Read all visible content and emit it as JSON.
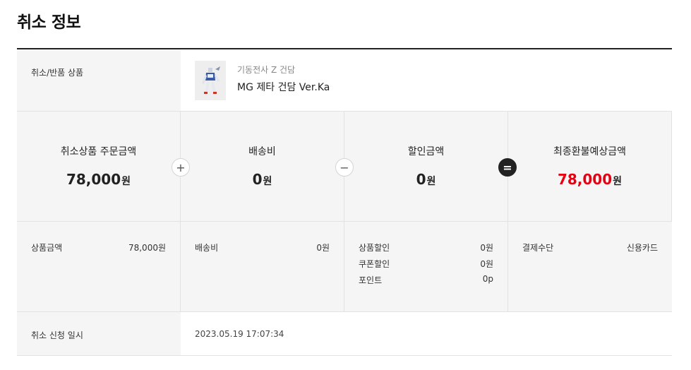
{
  "page_title": "취소 정보",
  "product": {
    "label": "취소/반품 상품",
    "category": "기동전사 Z 건담",
    "name": "MG 제타 건담 Ver.Ka"
  },
  "summary": [
    {
      "label": "취소상품 주문금액",
      "amount": "78,000",
      "unit": "원"
    },
    {
      "label": "배송비",
      "amount": "0",
      "unit": "원"
    },
    {
      "label": "할인금액",
      "amount": "0",
      "unit": "원"
    },
    {
      "label": "최종환불예상금액",
      "amount": "78,000",
      "unit": "원"
    }
  ],
  "operators": {
    "plus": "+",
    "minus": "−",
    "equals": "="
  },
  "details": {
    "product_amount": {
      "label": "상품금액",
      "value": "78,000원"
    },
    "shipping": {
      "label": "배송비",
      "value": "0원"
    },
    "discounts": [
      {
        "label": "상품할인",
        "value": "0원"
      },
      {
        "label": "쿠폰할인",
        "value": "0원"
      },
      {
        "label": "포인트",
        "value": "0p"
      }
    ],
    "payment": {
      "label": "결제수단",
      "value": "신용카드"
    }
  },
  "cancel_date": {
    "label": "취소 신청 일시",
    "value": "2023.05.19 17:07:34"
  },
  "colors": {
    "accent_red": "#e60013",
    "dark": "#222222",
    "panel": "#f5f5f5"
  }
}
